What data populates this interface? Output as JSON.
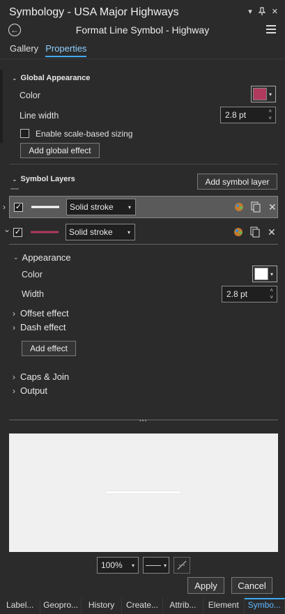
{
  "window": {
    "title": "Symbology - USA Major Highways",
    "subtitle": "Format Line Symbol - Highway",
    "pin_glyph": "▾",
    "pin2_glyph": "⊥",
    "close_glyph": "✕",
    "back_glyph": "←"
  },
  "tabs": [
    "Gallery",
    "Properties"
  ],
  "global": {
    "header": "Global Appearance",
    "color_label": "Color",
    "color_value": "#b03a5e",
    "line_width_label": "Line width",
    "line_width_value": "2.8 pt",
    "scale_label": "Enable scale-based sizing",
    "add_global_effect": "Add global effect"
  },
  "layers": {
    "header": "Symbol Layers",
    "add_symbol_layer": "Add symbol layer",
    "rows": [
      {
        "type": "Solid stroke",
        "stroke_color": "#ffffff",
        "checked": "✓"
      },
      {
        "type": "Solid stroke",
        "stroke_color": "#b03a5e",
        "checked": "✓"
      }
    ]
  },
  "appearance": {
    "header": "Appearance",
    "color_label": "Color",
    "color_value": "#ffffff",
    "width_label": "Width",
    "width_value": "2.8 pt",
    "offset_effect": "Offset effect",
    "dash_effect": "Dash effect",
    "add_effect": "Add effect",
    "caps_join": "Caps & Join",
    "output": "Output"
  },
  "preview": {
    "zoom": "100%"
  },
  "actions": {
    "apply": "Apply",
    "cancel": "Cancel"
  },
  "bottom_tabs": [
    "Label...",
    "Geopro...",
    "History",
    "Create...",
    "Attrib...",
    "Element",
    "Symbo..."
  ],
  "icons": {
    "expand": "›",
    "collapse": "⌄",
    "dropdown": "▾",
    "up": "˄",
    "down": "˅"
  }
}
